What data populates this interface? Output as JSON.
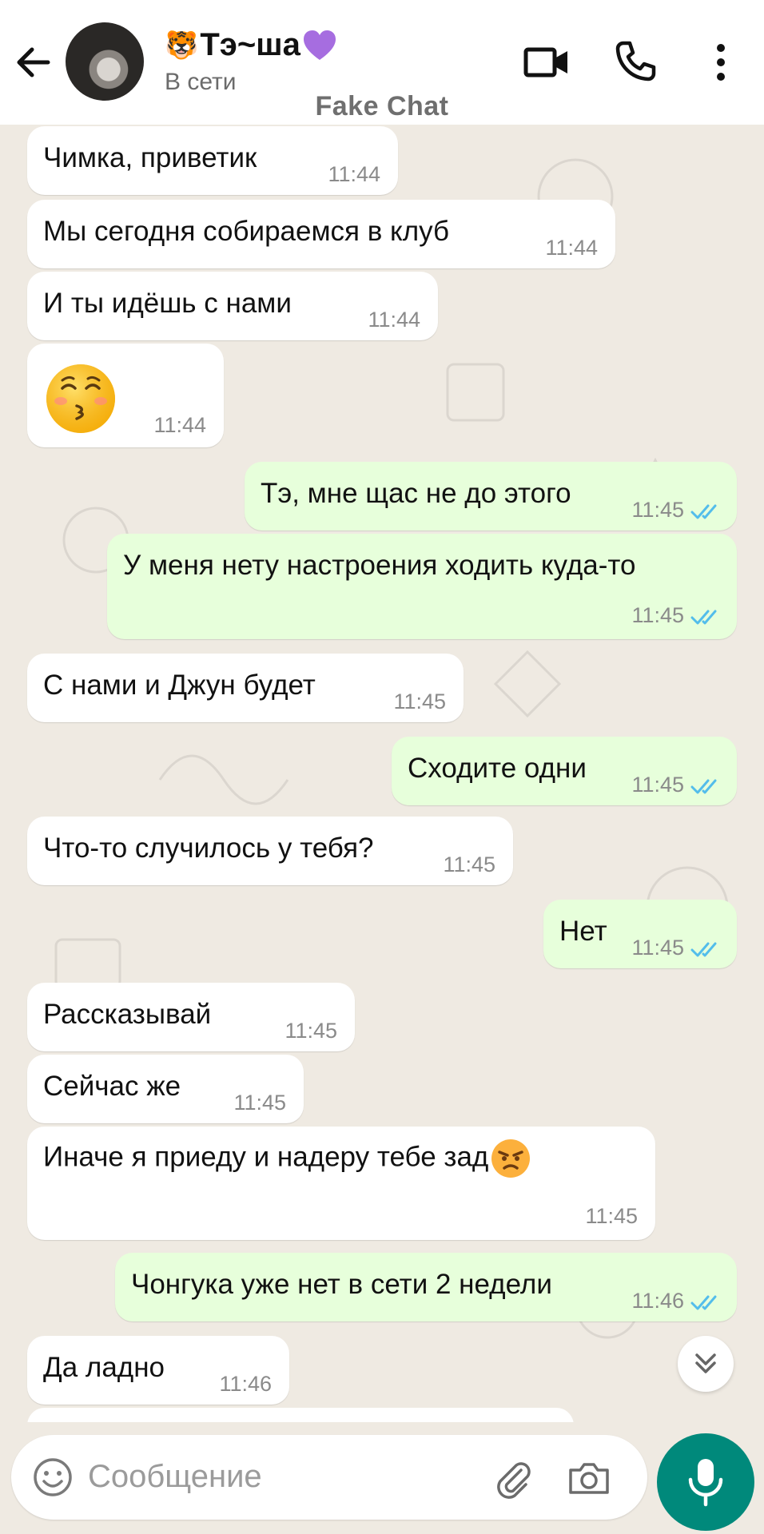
{
  "header": {
    "contact_name": "Тэ~ша",
    "name_prefix_emoji": "🐯",
    "status": "В сети",
    "watermark": "Fake Chat"
  },
  "messages": [
    {
      "direction": "in",
      "text": "Чимка, приветик",
      "time": "11:44"
    },
    {
      "direction": "in",
      "text": "Мы сегодня собираемся в клуб",
      "time": "11:44"
    },
    {
      "direction": "in",
      "text": "И ты идёшь с нами",
      "time": "11:44"
    },
    {
      "direction": "in",
      "emoji": "kissing-face-with-closed-eyes",
      "time": "11:44"
    },
    {
      "direction": "out",
      "text": "Тэ, мне щас не до этого",
      "time": "11:45",
      "status": "read"
    },
    {
      "direction": "out",
      "text": "У меня нету настроения ходить куда-то",
      "time": "11:45",
      "status": "read"
    },
    {
      "direction": "in",
      "text": "С нами и Джун будет",
      "time": "11:45"
    },
    {
      "direction": "out",
      "text": "Сходите одни",
      "time": "11:45",
      "status": "read"
    },
    {
      "direction": "in",
      "text": "Что-то случилось у тебя?",
      "time": "11:45"
    },
    {
      "direction": "out",
      "text": "Нет",
      "time": "11:45",
      "status": "read"
    },
    {
      "direction": "in",
      "text": "Рассказывай",
      "time": "11:45"
    },
    {
      "direction": "in",
      "text": "Сейчас же",
      "time": "11:45"
    },
    {
      "direction": "in",
      "text": "Иначе я приеду и надеру тебе зад",
      "trailing_emoji": "angry-face",
      "time": "11:45"
    },
    {
      "direction": "out",
      "text": "Чонгука уже нет в сети 2 недели",
      "time": "11:46",
      "status": "read"
    },
    {
      "direction": "in",
      "text": "Да ладно",
      "time": "11:46"
    }
  ],
  "composer": {
    "placeholder": "Сообщение"
  },
  "icons": {
    "back": "arrow-left-icon",
    "video": "video-camera-icon",
    "call": "phone-icon",
    "menu": "more-vertical-icon",
    "emoji": "emoji-icon",
    "attach": "paperclip-icon",
    "camera": "camera-icon",
    "mic": "microphone-icon",
    "scroll_down": "chevrons-down-icon",
    "read_ticks": "double-check-icon"
  },
  "colors": {
    "header_bg": "#ffffff",
    "chat_bg": "#efeae2",
    "incoming_bubble": "#ffffff",
    "outgoing_bubble": "#e7ffdb",
    "read_ticks": "#53bdeb",
    "mic_button": "#00897b",
    "heart": "#a66de0"
  }
}
